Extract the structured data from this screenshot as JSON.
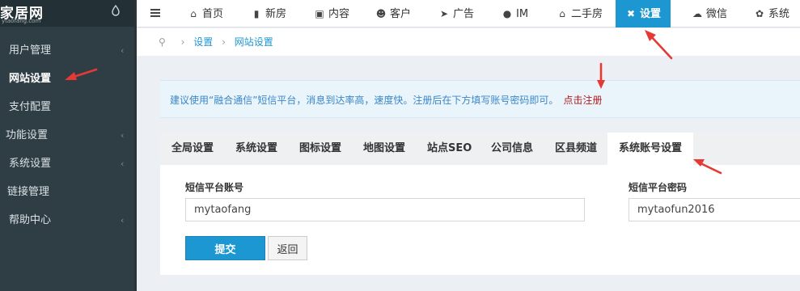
{
  "logo": {
    "text": "家居网",
    "subtext": "ytaofang.com"
  },
  "sidebar": {
    "items": [
      {
        "label": "用户管理",
        "has_chevron": true
      },
      {
        "label": "网站设置",
        "has_chevron": false
      },
      {
        "label": "支付配置",
        "has_chevron": false
      },
      {
        "label": "功能设置",
        "has_chevron": true
      },
      {
        "label": "系统设置",
        "has_chevron": true
      },
      {
        "label": "链接管理",
        "has_chevron": false
      },
      {
        "label": "帮助中心",
        "has_chevron": true
      }
    ]
  },
  "topnav": {
    "items": [
      {
        "label": "首页",
        "icon": "home-icon",
        "glyph": "⌂"
      },
      {
        "label": "新房",
        "icon": "building-icon",
        "glyph": "▮"
      },
      {
        "label": "内容",
        "icon": "content-icon",
        "glyph": "▣"
      },
      {
        "label": "客户",
        "icon": "users-icon",
        "glyph": "☻"
      },
      {
        "label": "广告",
        "icon": "send-icon",
        "glyph": "➤"
      },
      {
        "label": "IM",
        "icon": "chat-icon",
        "glyph": "●"
      },
      {
        "label": "二手房",
        "icon": "home-icon",
        "glyph": "⌂"
      },
      {
        "label": "设置",
        "icon": "settings-icon",
        "glyph": "✖"
      },
      {
        "label": "微信",
        "icon": "wechat-icon",
        "glyph": "☁"
      },
      {
        "label": "系统",
        "icon": "gear-icon",
        "glyph": "✿"
      }
    ]
  },
  "breadcrumb": {
    "items": [
      "设置",
      "网站设置"
    ]
  },
  "notice": {
    "text": "建议使用“融合通信”短信平台，消息到达率高，速度快。注册后在下方填写账号密码即可。",
    "link": "点击注册"
  },
  "tabs": [
    "全局设置",
    "系统设置",
    "图标设置",
    "地图设置",
    "站点SEO",
    "公司信息",
    "区县频道",
    "系统账号设置"
  ],
  "form": {
    "account_label": "短信平台账号",
    "account_value": "mytaofang",
    "password_label": "短信平台密码",
    "password_value": "mytaofun2016",
    "submit_label": "提交",
    "back_label": "返回"
  },
  "colors": {
    "accent": "#1d97d1",
    "sidebar": "#2f3e45",
    "annotation": "#e53935"
  }
}
